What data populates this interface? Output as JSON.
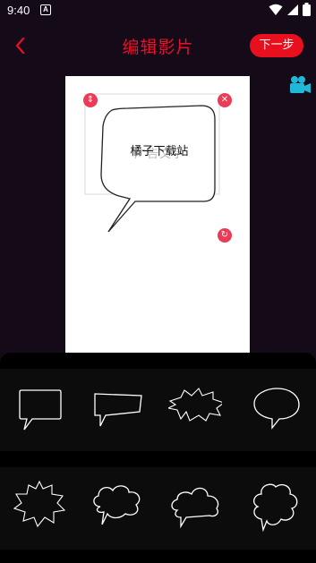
{
  "status": {
    "time": "9:40",
    "notification_icon": "A"
  },
  "header": {
    "title": "编辑影片",
    "next_label": "下一步"
  },
  "canvas": {
    "bubble_text": "橘子下载站",
    "bubble_text_shadow": "广告文字"
  },
  "colors": {
    "accent": "#e8101e",
    "title": "#e8102a",
    "control": "#ec3b56",
    "camera": "#1fb8d8"
  },
  "bubble_templates": [
    "speech-bubble-rounded",
    "speech-bubble-rect",
    "speech-bubble-burst",
    "speech-bubble-oval",
    "speech-bubble-spiky",
    "speech-bubble-cloud",
    "speech-bubble-cloud-small",
    "speech-bubble-cloud-tall"
  ]
}
